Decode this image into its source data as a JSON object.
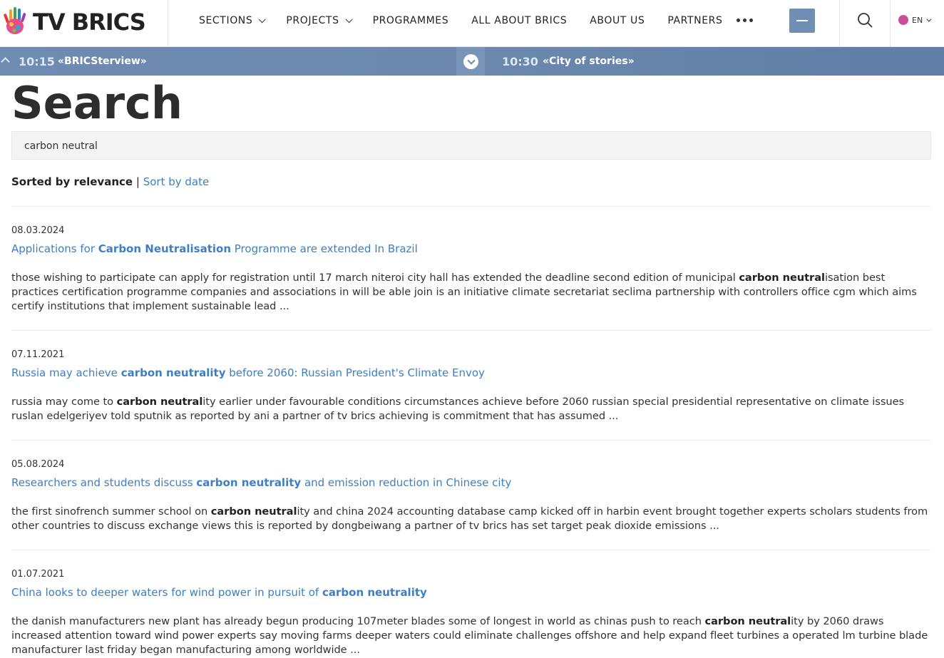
{
  "header": {
    "logo_text": "TV BRICS",
    "nav": [
      {
        "label": "SECTIONS",
        "dropdown": true
      },
      {
        "label": "PROJECTS",
        "dropdown": true
      },
      {
        "label": "PROGRAMMES",
        "dropdown": false
      },
      {
        "label": "ALL ABOUT BRICS",
        "dropdown": false
      },
      {
        "label": "ABOUT US",
        "dropdown": false
      },
      {
        "label": "PARTNERS",
        "dropdown": false
      }
    ],
    "more_icon": "ellipsis-icon",
    "menu_icon": "hamburger-icon",
    "search_icon": "search-icon",
    "language": "EN",
    "language_dot_color": "#c9509f"
  },
  "schedule": {
    "current_time": "10:15",
    "current_show": "«BRICSterview»",
    "next_time": "10:30",
    "next_show": "«City of stories»",
    "bar_color": "#6e8bb2"
  },
  "page": {
    "title": "Search",
    "query": "carbon neutral",
    "sort_current": "Sorted by relevance",
    "sort_separator": "|",
    "sort_alternative": "Sort by date",
    "link_color": "#3d7fc0"
  },
  "results": [
    {
      "date": "08.03.2024",
      "title": [
        {
          "text": "Applications for ",
          "bold": false
        },
        {
          "text": "Carbon Neutralisation",
          "bold": true
        },
        {
          "text": " Programme are extended In Brazil",
          "bold": false
        }
      ],
      "snippet": [
        {
          "text": "those wishing to participate can apply for registration until 17 march niteroi city hall has extended the deadline second edition of municipal ",
          "bold": false
        },
        {
          "text": "carbon neutral",
          "bold": true
        },
        {
          "text": "isation best practices certification programme companies and associations in will be able join is an initiative climate secretariat seclima partnership with controllers office cgm which aims certify institutions that implement sustainable lead ...",
          "bold": false
        }
      ]
    },
    {
      "date": "07.11.2021",
      "title": [
        {
          "text": "Russia may achieve ",
          "bold": false
        },
        {
          "text": "carbon neutrality",
          "bold": true
        },
        {
          "text": " before 2060: Russian President's Climate Envoy",
          "bold": false
        }
      ],
      "snippet": [
        {
          "text": "russia may come to ",
          "bold": false
        },
        {
          "text": "carbon neutral",
          "bold": true
        },
        {
          "text": "ity earlier under favourable conditions circumstances achieve before 2060 russian special presidential representative on climate issues ruslan edelgeriyev told sputnik as reported by ani a partner of tv brics achieving is commitment that has assumed ...",
          "bold": false
        }
      ]
    },
    {
      "date": "05.08.2024",
      "title": [
        {
          "text": "Researchers and students discuss ",
          "bold": false
        },
        {
          "text": "carbon neutrality",
          "bold": true
        },
        {
          "text": " and emission reduction in Chinese city",
          "bold": false
        }
      ],
      "snippet": [
        {
          "text": "the first sinofrench summer school on ",
          "bold": false
        },
        {
          "text": "carbon neutral",
          "bold": true
        },
        {
          "text": "ity and china 2024 accounting database camp kicked off in harbin event brought together experts scholars students from other countries to discuss exchange views this is reported by dongbeiwang a partner of tv brics has set target peak dioxide emissions ...",
          "bold": false
        }
      ]
    },
    {
      "date": "01.07.2021",
      "title": [
        {
          "text": "China looks to deeper waters for wind power in pursuit of ",
          "bold": false
        },
        {
          "text": "carbon neutrality",
          "bold": true
        }
      ],
      "snippet": [
        {
          "text": "the danish manufacturers new plant has already begun producing 107meter blades some of longest in world as chinas push to reach ",
          "bold": false
        },
        {
          "text": "carbon neutral",
          "bold": true
        },
        {
          "text": "ity by 2060 draws increased attention toward wind power experts say moving farms deeper waters could eliminate challenges offshore and help expand fleet turbines a operated lm turbine blade manufacturer last friday began manufacturing among worldwide ...",
          "bold": false
        }
      ]
    }
  ]
}
